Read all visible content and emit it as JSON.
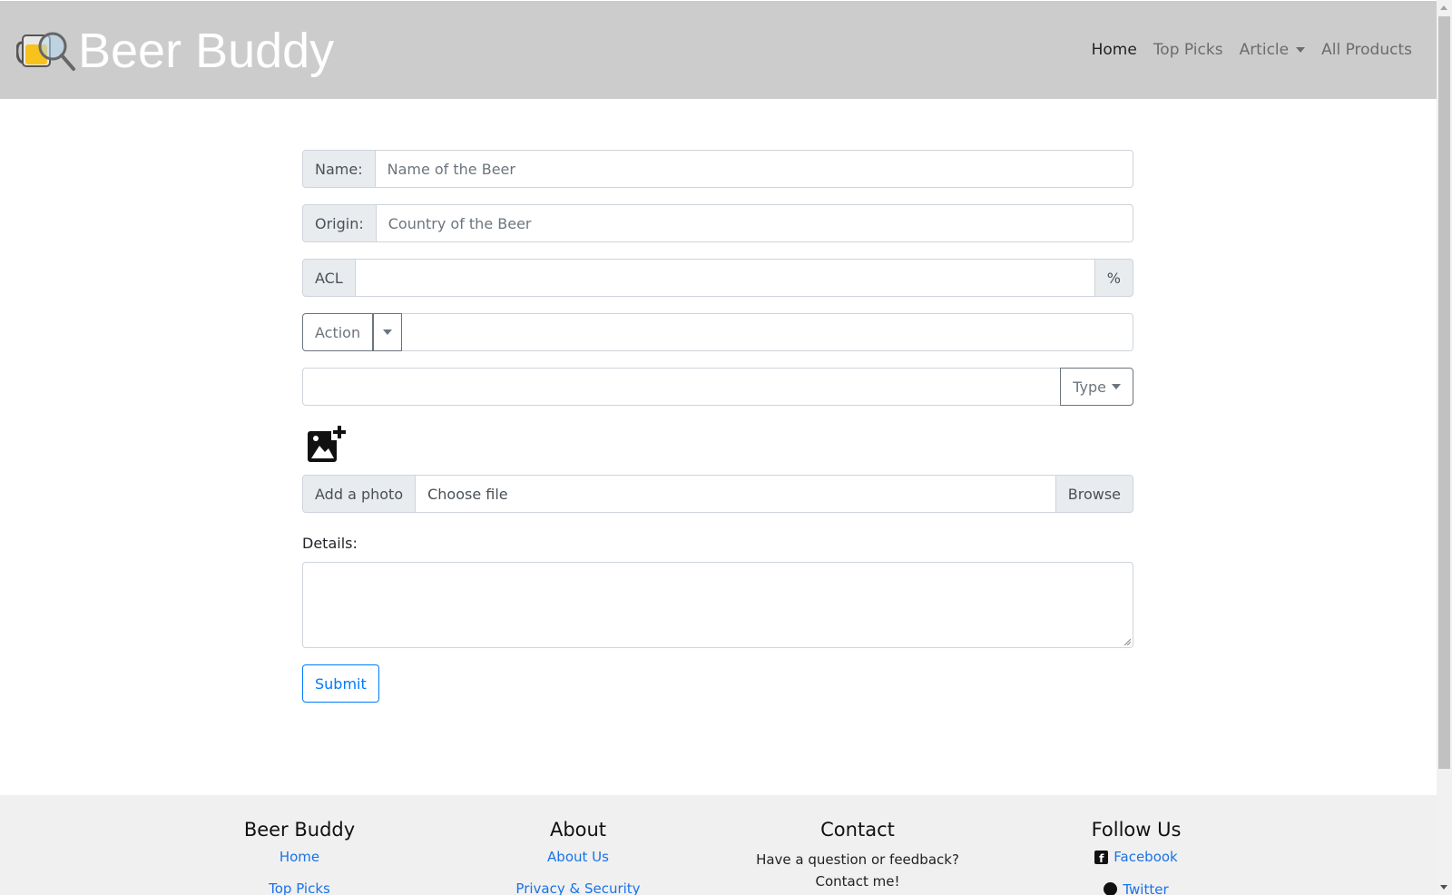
{
  "brand": {
    "name": "Beer Buddy",
    "logo_icon": "beer-mug-magnifier-icon"
  },
  "nav": {
    "home": "Home",
    "top_picks": "Top Picks",
    "article": "Article",
    "all_products": "All Products"
  },
  "form": {
    "name_label": "Name:",
    "name_placeholder": "Name of the Beer",
    "origin_label": "Origin:",
    "origin_placeholder": "Country of the Beer",
    "acl_label": "ACL",
    "acl_unit": "%",
    "action_label": "Action",
    "type_label": "Type",
    "photo_icon": "add-photo-icon",
    "add_photo_label": "Add a photo",
    "file_text": "Choose file",
    "browse_label": "Browse",
    "details_label": "Details:",
    "submit_label": "Submit"
  },
  "footer": {
    "col1": {
      "title": "Beer Buddy",
      "links": [
        "Home",
        "Top Picks"
      ]
    },
    "col2": {
      "title": "About",
      "links": [
        "About Us",
        "Privacy & Security"
      ]
    },
    "col3": {
      "title": "Contact",
      "line1": "Have a question or feedback?",
      "line2": "Contact me!"
    },
    "col4": {
      "title": "Follow Us",
      "links": [
        "Facebook",
        "Twitter"
      ]
    }
  },
  "colors": {
    "navbar": "#cccccc",
    "link": "#1a73e8",
    "primary": "#007bff"
  }
}
